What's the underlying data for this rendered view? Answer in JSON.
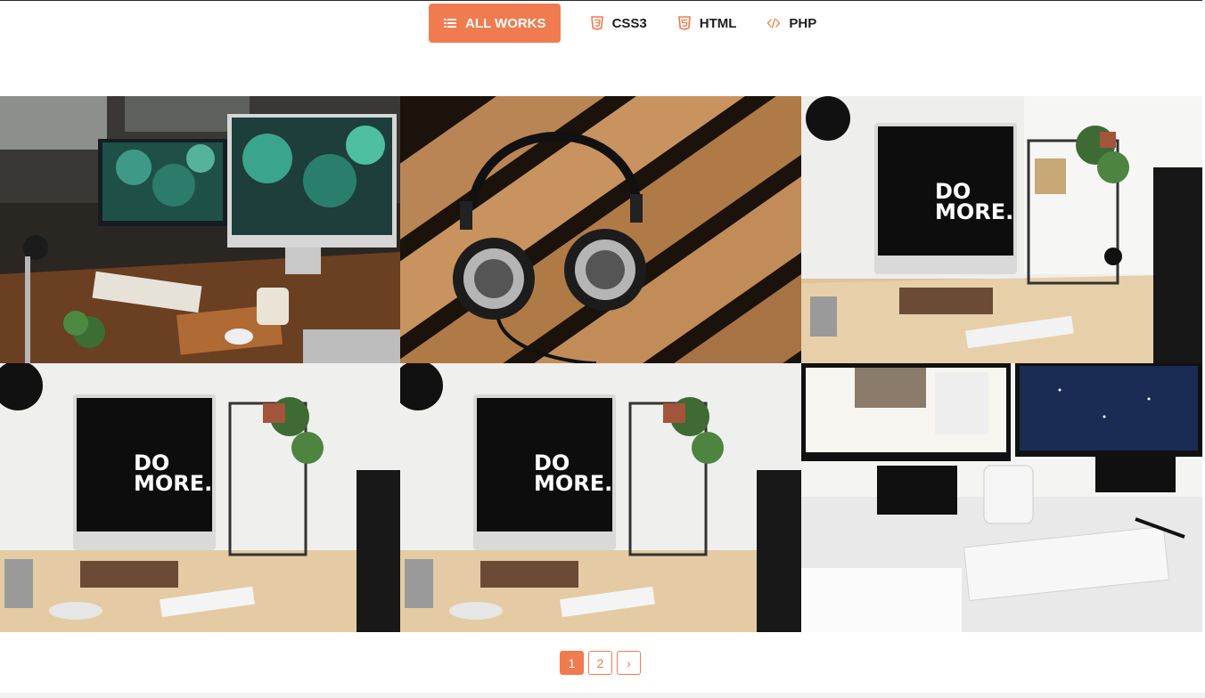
{
  "colors": {
    "accent": "#f07b4f",
    "text": "#1e1e1e",
    "background": "#ffffff"
  },
  "filters": [
    {
      "label": "ALL WORKS",
      "icon": "list-icon",
      "active": true
    },
    {
      "label": "CSS3",
      "icon": "css3-icon",
      "active": false
    },
    {
      "label": "HTML",
      "icon": "html5-icon",
      "active": false
    },
    {
      "label": "PHP",
      "icon": "code-icon",
      "active": false
    }
  ],
  "portfolio": {
    "items": [
      {
        "scene": "desk-dual-monitors"
      },
      {
        "scene": "headphones-on-wood"
      },
      {
        "scene": "do-more-desk"
      },
      {
        "scene": "do-more-desk"
      },
      {
        "scene": "do-more-desk"
      },
      {
        "scene": "monitors-mug-keyboard"
      }
    ],
    "screen_text": [
      "DO",
      "MORE."
    ]
  },
  "pagination": {
    "pages": [
      "1",
      "2"
    ],
    "current": "1",
    "next": "›"
  }
}
